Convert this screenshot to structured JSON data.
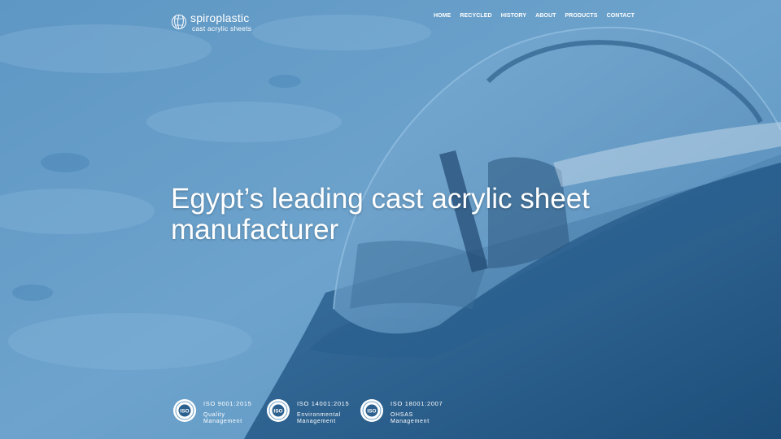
{
  "brand": {
    "name": "spiroplastic",
    "tagline": "cast acrylic sheets"
  },
  "nav": [
    {
      "label": "HOME"
    },
    {
      "label": "RECYCLED"
    },
    {
      "label": "HISTORY"
    },
    {
      "label": "ABOUT"
    },
    {
      "label": "PRODUCTS"
    },
    {
      "label": "CONTACT"
    }
  ],
  "hero": {
    "headline": "Egypt’s leading cast acrylic sheet manufacturer"
  },
  "certifications": [
    {
      "code": "ISO 9001:2015",
      "description": "Quality Management",
      "badge_text": "ISO"
    },
    {
      "code": "ISO 14001:2015",
      "description": "Environmental Management",
      "badge_text": "ISO"
    },
    {
      "code": "ISO 18001:2007",
      "description": "OHSAS Management",
      "badge_text": "ISO"
    }
  ],
  "colors": {
    "overlay": "#4a88b8",
    "text": "#ffffff",
    "dark_blue": "#1e4e78"
  }
}
